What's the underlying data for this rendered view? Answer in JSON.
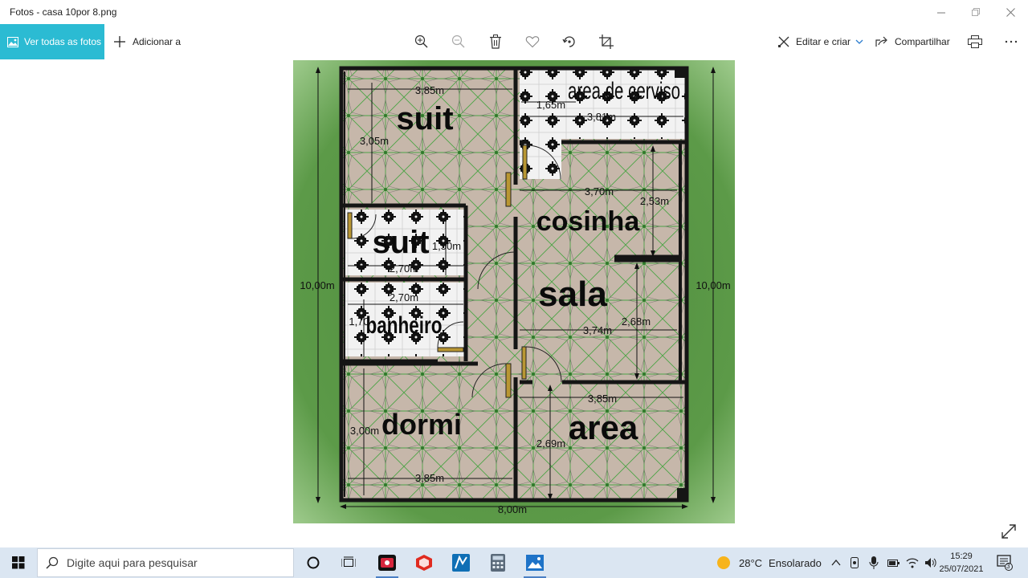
{
  "window": {
    "title": "Fotos - casa 10por 8.png",
    "minimize_icon": "minimize-icon",
    "maximize_icon": "maximize-icon",
    "close_icon": "close-icon"
  },
  "toolbar": {
    "see_all_label": "Ver todas as fotos",
    "add_label": "Adicionar a",
    "edit_label": "Editar e criar",
    "share_label": "Compartilhar",
    "icons": [
      "zoom-in-icon",
      "zoom-out-icon",
      "delete-icon",
      "favorite-icon",
      "rotate-icon",
      "crop-icon",
      "print-icon",
      "more-icon"
    ]
  },
  "plan": {
    "rooms": {
      "suit1": "suit",
      "servico": "area de cerviso",
      "suit2": "suit",
      "cozinha": "cosinha",
      "sala": "sala",
      "banheiro": "banheiro",
      "dormi": "dormi",
      "area": "area"
    },
    "dims": {
      "suit_w": "3,85m",
      "suit_h": "3,05m",
      "serv_w1": "1,65m",
      "serv_w2": "3,81m",
      "coz_w": "3,70m",
      "coz_h": "2,53m",
      "suit2_w": "2,70m",
      "suit2_h": "1,50m",
      "ban_w": "2,70m",
      "ban_h": "1,70",
      "sala_w": "3,74m",
      "sala_h": "2,68m",
      "area_w": "3,85m",
      "area_h": "2,69m",
      "dormi_h": "3,00m",
      "dormi_w": "3,85m",
      "total_h_left": "10,00m",
      "total_h_right": "10,00m",
      "total_w": "8,00m"
    },
    "colors": {
      "lawn": "#5c9a48",
      "floor": "#c4b4a6",
      "tile_line": "#3aa33a",
      "wall": "#151515",
      "white_tile": "#f1f1f1"
    }
  },
  "taskbar": {
    "search_placeholder": "Digite aqui para pesquisar",
    "weather_temp": "28°C",
    "weather_desc": "Ensolarado",
    "time": "15:29",
    "date": "25/07/2021",
    "notification_count": "3"
  }
}
